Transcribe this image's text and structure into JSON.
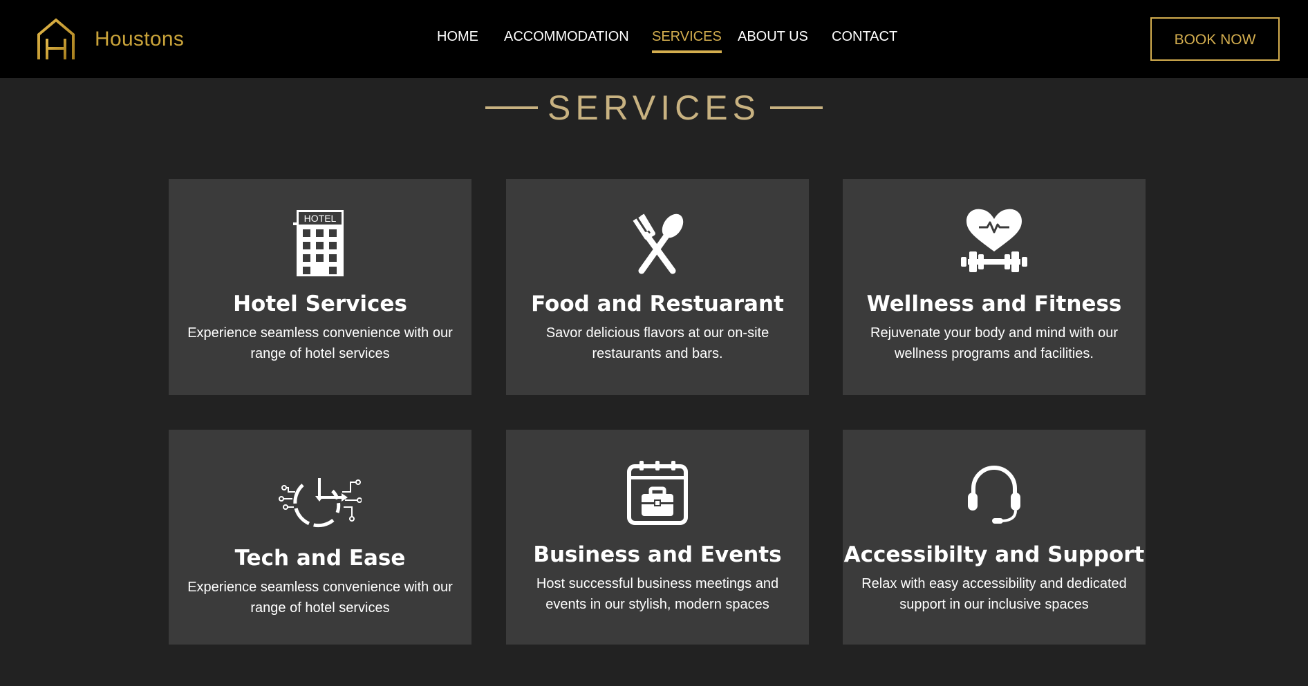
{
  "brand": {
    "name": "Houstons",
    "accent": "#D4AE4F",
    "heading_color": "#C8B281"
  },
  "nav": {
    "items": [
      {
        "label": "HOME"
      },
      {
        "label": "ACCOMMODATION"
      },
      {
        "label": "SERVICES",
        "active": true
      },
      {
        "label": "ABOUT US"
      },
      {
        "label": "CONTACT"
      }
    ],
    "cta": "BOOK NOW"
  },
  "section": {
    "title": "SERVICES"
  },
  "services": [
    {
      "icon": "hotel-building-icon",
      "icon_text": "HOTEL",
      "title": "Hotel Services",
      "description": "Experience seamless convenience with our range of hotel services"
    },
    {
      "icon": "fork-spoon-icon",
      "title": "Food and Restuarant",
      "description": "Savor delicious flavors at our on-site restaurants and bars."
    },
    {
      "icon": "heart-dumbbell-icon",
      "title": "Wellness and Fitness",
      "description": "Rejuvenate your body and mind with our wellness programs and facilities."
    },
    {
      "icon": "clock-circuit-icon",
      "title": "Tech and Ease",
      "description": "Experience seamless convenience with our range of hotel services"
    },
    {
      "icon": "calendar-briefcase-icon",
      "title": "Business and Events",
      "description": "Host successful business meetings and events in our stylish, modern spaces"
    },
    {
      "icon": "headset-icon",
      "title": "Accessibilty and Support",
      "description": "Relax with easy accessibility and dedicated support in our inclusive spaces"
    }
  ]
}
